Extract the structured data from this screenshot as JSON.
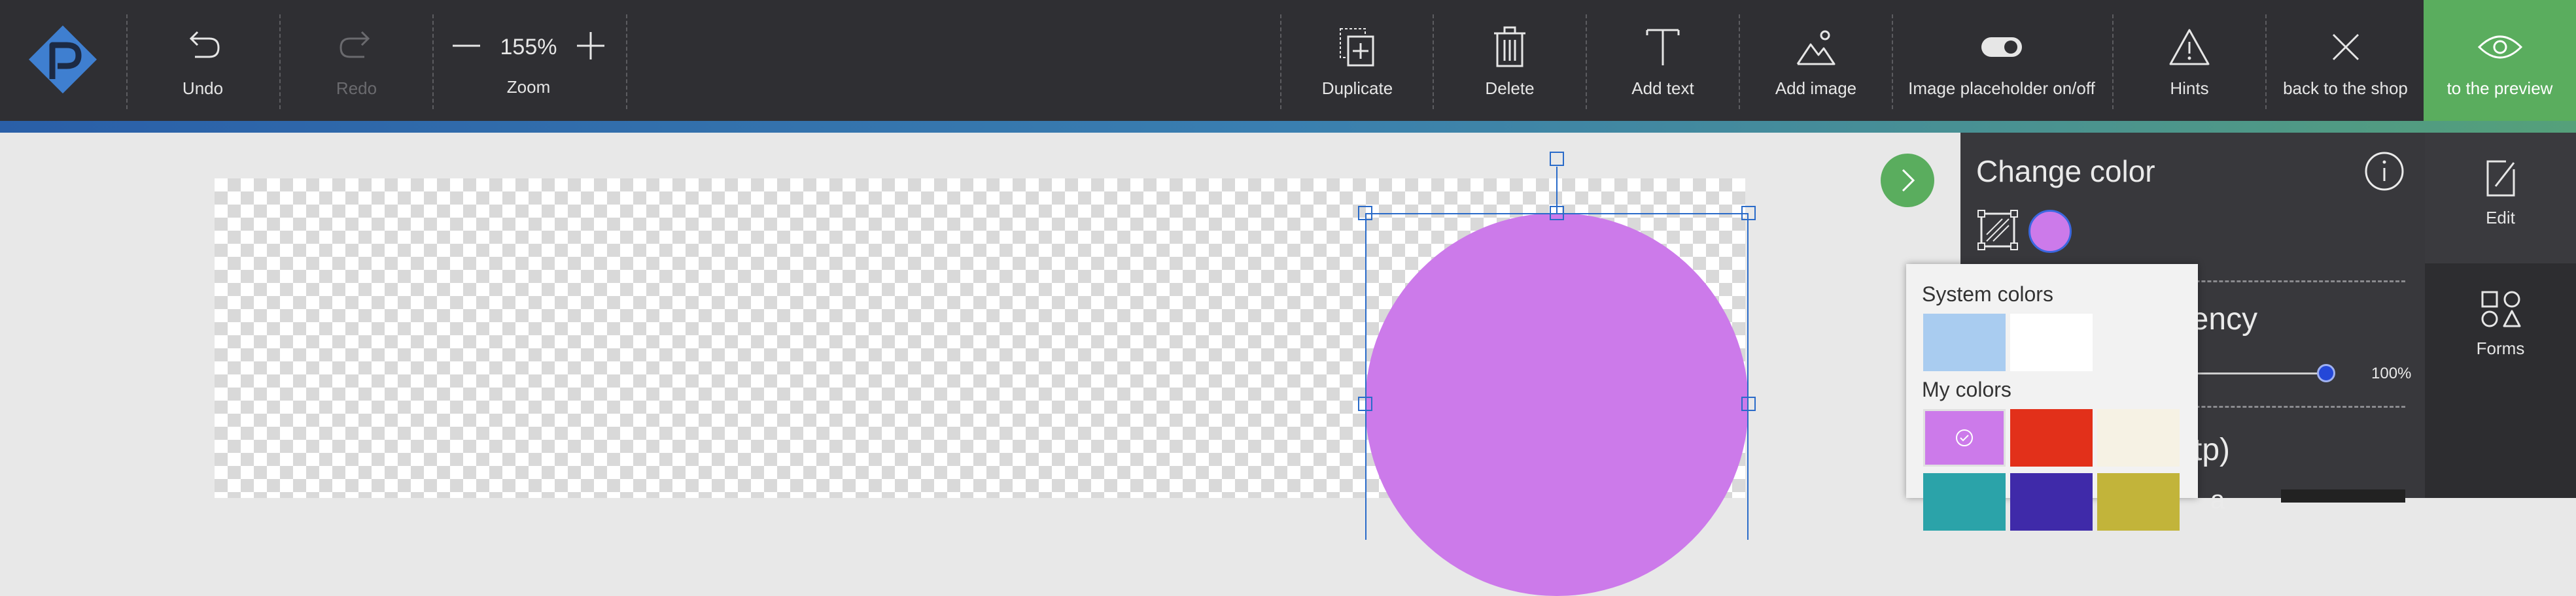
{
  "toolbar": {
    "undo_label": "Undo",
    "redo_label": "Redo",
    "zoom_value": "155%",
    "zoom_label": "Zoom",
    "duplicate_label": "Duplicate",
    "delete_label": "Delete",
    "add_text_label": "Add text",
    "add_image_label": "Add image",
    "placeholder_label": "Image placeholder on/off",
    "hints_label": "Hints",
    "back_label": "back to the shop",
    "preview_label": "to the preview"
  },
  "panel": {
    "title": "Change color",
    "transparency_label": "arency",
    "transparency_value": "100%",
    "tp_label": "tp)",
    "cutoff_text": "a"
  },
  "sidebar": {
    "items": [
      {
        "label": "Edit"
      },
      {
        "label": "Forms"
      }
    ]
  },
  "picker": {
    "system_label": "System colors",
    "my_label": "My colors",
    "system_colors": [
      "#a9ccf0",
      "#ffffff"
    ],
    "my_colors": [
      "#cc7aea",
      "#e2301a",
      "#f6f2e4",
      "#2ba3a9",
      "#3f2aa9",
      "#c2b43a"
    ]
  },
  "colors": {
    "shape_fill": "#cc7aea",
    "accent_green": "#5aad5e",
    "selection_blue": "#2a6bc9"
  }
}
